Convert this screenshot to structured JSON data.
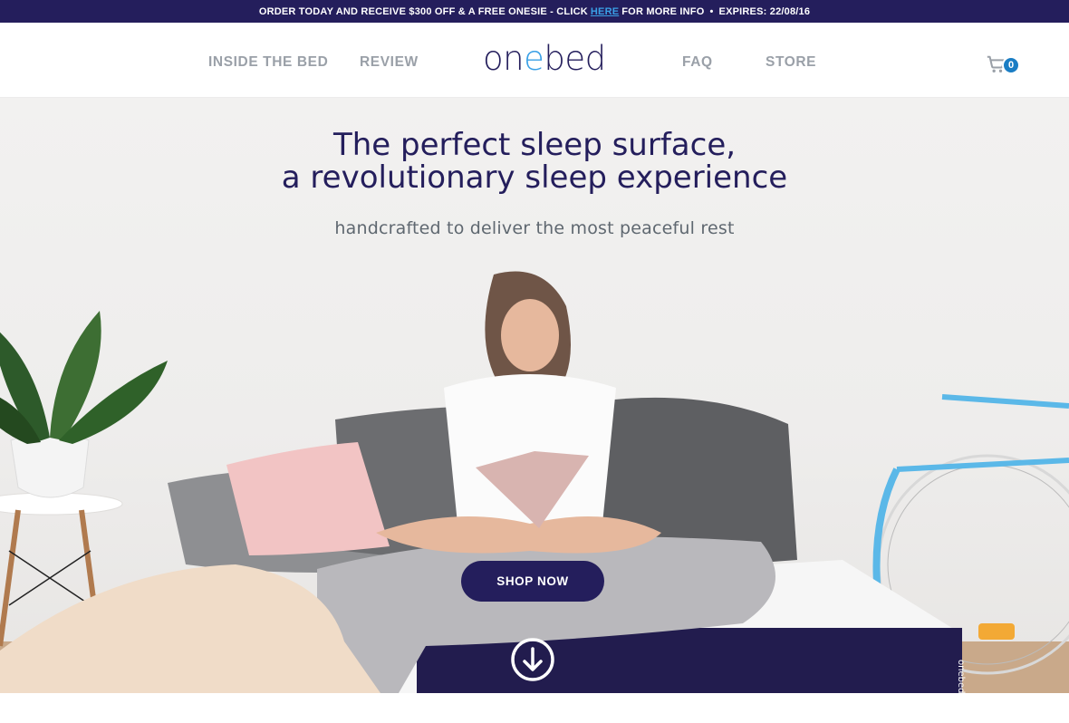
{
  "promo": {
    "before_link": "ORDER TODAY AND RECEIVE $300 OFF & A FREE ONESIE - CLICK",
    "link_text": "HERE",
    "after_link": "FOR MORE INFO",
    "separator": "•",
    "expires": "EXPIRES: 22/08/16"
  },
  "nav": {
    "left": [
      "INSIDE THE BED",
      "REVIEW"
    ],
    "logo_parts": [
      "on",
      "e",
      "bed"
    ],
    "right": [
      "FAQ",
      "STORE"
    ],
    "cart_count": "0"
  },
  "hero": {
    "headline_line1": "The perfect sleep surface,",
    "headline_line2": "a revolutionary sleep experience",
    "subheadline": "handcrafted to deliver the most peaceful rest",
    "cta_label": "SHOP NOW",
    "mattress_label": "onebed"
  },
  "colors": {
    "brand_navy": "#241e5c",
    "accent_blue": "#3aa0e6",
    "nav_grey": "#9aa0a8",
    "cart_badge": "#1a7dc4"
  },
  "icons": [
    "cart-icon",
    "scroll-down-arrow-icon"
  ]
}
